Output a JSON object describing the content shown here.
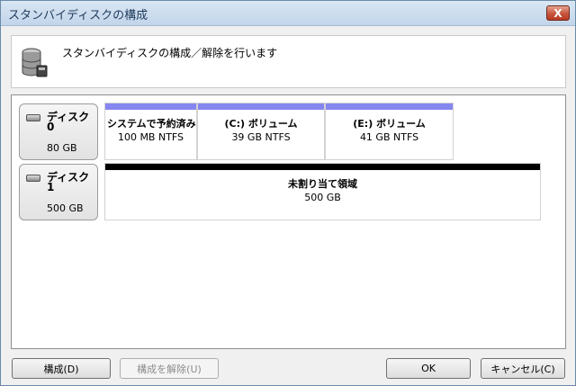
{
  "window": {
    "title": "スタンバイディスクの構成",
    "close_label": "X"
  },
  "header": {
    "description": "スタンバイディスクの構成／解除を行います",
    "icon": "database-disk-icon"
  },
  "disks": [
    {
      "name": "ディスク 0",
      "size": "80 GB",
      "partitions": [
        {
          "name": "システムで予約済み",
          "info": "100 MB NTFS",
          "bar_color": "#8686f0"
        },
        {
          "name": "(C:) ボリューム",
          "info": "39 GB NTFS",
          "bar_color": "#8686f0"
        },
        {
          "name": "(E:) ボリューム",
          "info": "41 GB NTFS",
          "bar_color": "#8686f0"
        }
      ]
    },
    {
      "name": "ディスク 1",
      "size": "500 GB",
      "partitions": [
        {
          "name": "未割り当て領域",
          "info": "500 GB",
          "bar_color": "#000000"
        }
      ]
    }
  ],
  "buttons": {
    "configure": "構成(D)",
    "release": "構成を解除(U)",
    "ok": "OK",
    "cancel": "キャンセル(C)"
  }
}
